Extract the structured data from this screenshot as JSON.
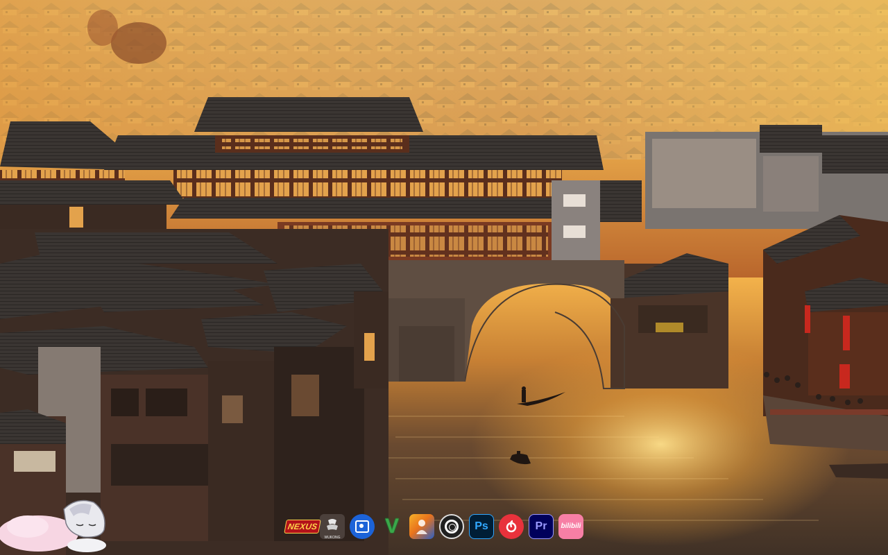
{
  "desktop": {
    "wallpaper": {
      "subject": "fenghuang-ancient-town-bridge-sunset",
      "colors": {
        "sky": "#f1c25a",
        "haze": "#e8a13a",
        "water": "#4a3a2a",
        "roof": "#3a3430",
        "wood": "#6a3a22",
        "glow": "#ffcf5a"
      }
    },
    "mascot": {
      "icon": "anime-character-sleeping-icon"
    },
    "dock": {
      "items": [
        {
          "id": "nexus",
          "label": "NEXUS",
          "icon": "nexus-mods-icon"
        },
        {
          "id": "wukong",
          "label": "WUKONG",
          "icon": "black-myth-wukong-icon"
        },
        {
          "id": "photos",
          "label": "",
          "icon": "photos-app-icon"
        },
        {
          "id": "gta",
          "label": "V",
          "icon": "gta-v-icon"
        },
        {
          "id": "game2",
          "label": "",
          "icon": "game-launcher-icon"
        },
        {
          "id": "obs",
          "label": "",
          "icon": "obs-studio-icon"
        },
        {
          "id": "ps",
          "label": "Ps",
          "icon": "photoshop-icon"
        },
        {
          "id": "music",
          "label": "",
          "icon": "netease-music-icon"
        },
        {
          "id": "pr",
          "label": "Pr",
          "icon": "premiere-pro-icon"
        },
        {
          "id": "bili",
          "label": "bilibili",
          "icon": "bilibili-icon"
        }
      ]
    }
  }
}
